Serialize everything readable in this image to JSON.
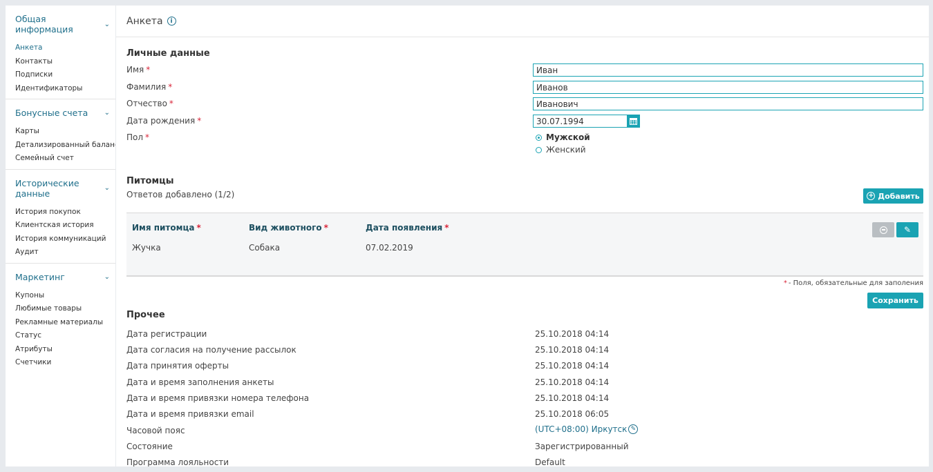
{
  "sidebar": {
    "sections": [
      {
        "title": "Общая информация",
        "items": [
          "Анкета",
          "Контакты",
          "Подписки",
          "Идентификаторы"
        ]
      },
      {
        "title": "Бонусные счета",
        "items": [
          "Карты",
          "Детализированный баланс",
          "Семейный счет"
        ]
      },
      {
        "title": "Исторические данные",
        "items": [
          "История покупок",
          "Клиентская история",
          "История коммуникаций",
          "Аудит"
        ]
      },
      {
        "title": "Маркетинг",
        "items": [
          "Купоны",
          "Любимые товары",
          "Рекламные материалы",
          "Статус",
          "Атрибуты",
          "Счетчики"
        ]
      }
    ],
    "active_item": "Анкета"
  },
  "header": {
    "title": "Анкета",
    "info_icon": "info-icon"
  },
  "personal": {
    "title": "Личные данные",
    "required_mark": "*",
    "first_name_label": "Имя",
    "first_name_value": "Иван",
    "last_name_label": "Фамилия",
    "last_name_value": "Иванов",
    "middle_name_label": "Отчество",
    "middle_name_value": "Иванович",
    "birth_label": "Дата рождения",
    "birth_value": "30.07.1994",
    "gender_label": "Пол",
    "gender_male": "Мужской",
    "gender_female": "Женский",
    "gender_selected": "Мужской"
  },
  "pets": {
    "title": "Питомцы",
    "answers": "Ответов добавлено (1/2)",
    "add_label": "Добавить",
    "columns": [
      "Имя питомца",
      "Вид животного",
      "Дата появления"
    ],
    "rows": [
      [
        "Жучка",
        "Собака",
        "07.02.2019"
      ]
    ]
  },
  "required_note": "- Поля, обязательные для заполения",
  "save_label": "Сохранить",
  "other": {
    "title": "Прочее",
    "rows": [
      {
        "label": "Дата регистрации",
        "value": "25.10.2018 04:14"
      },
      {
        "label": "Дата согласия на получение рассылок",
        "value": "25.10.2018 04:14"
      },
      {
        "label": "Дата принятия оферты",
        "value": "25.10.2018 04:14"
      },
      {
        "label": "Дата и время заполнения анкеты",
        "value": "25.10.2018 04:14"
      },
      {
        "label": "Дата и время привязки номера телефона",
        "value": "25.10.2018 04:14"
      },
      {
        "label": "Дата и время привязки email",
        "value": "25.10.2018 06:05"
      },
      {
        "label": "Часовой пояс",
        "value": "(UTC+08:00) Иркутск"
      },
      {
        "label": "Состояние",
        "value": "Зарегистрированный"
      },
      {
        "label": "Программа лояльности",
        "value": "Default"
      }
    ]
  },
  "colors": {
    "accent": "#1aa3b3",
    "link": "#1f6f8b",
    "required": "#d9263a"
  }
}
